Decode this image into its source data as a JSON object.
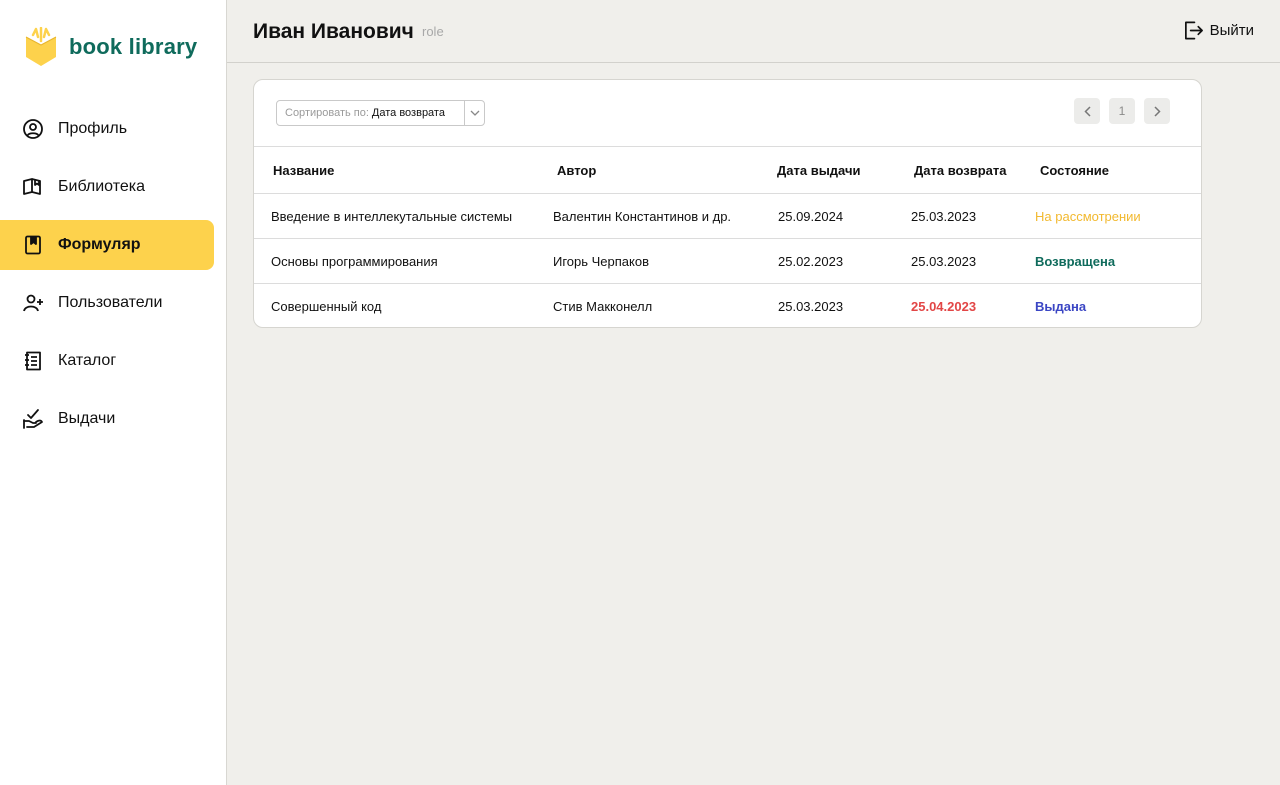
{
  "app": {
    "logo_text": "book library"
  },
  "sidebar": {
    "items": [
      {
        "label": "Профиль",
        "icon": "user-circle-icon",
        "active": false
      },
      {
        "label": "Библиотека",
        "icon": "open-book-icon",
        "active": false
      },
      {
        "label": "Формуляр",
        "icon": "bookmark-book-icon",
        "active": true
      },
      {
        "label": "Пользователи",
        "icon": "user-add-icon",
        "active": false
      },
      {
        "label": "Каталог",
        "icon": "catalog-icon",
        "active": false
      },
      {
        "label": "Выдачи",
        "icon": "hand-check-icon",
        "active": false
      }
    ]
  },
  "header": {
    "user_name": "Иван Иванович",
    "role": "role",
    "logout_label": "Выйти"
  },
  "toolbar": {
    "sort_prefix": "Сортировать по:",
    "sort_value": "Дата возврата",
    "page_number": "1"
  },
  "table": {
    "columns": [
      "Название",
      "Автор",
      "Дата выдачи",
      "Дата возврата",
      "Состояние"
    ],
    "rows": [
      {
        "title": "Введение в интеллекутальные системы",
        "author": "Валентин Константинов и др.",
        "issued": "25.09.2024",
        "returned": "25.03.2023",
        "status": "На рассмотрении"
      },
      {
        "title": "Основы программирования",
        "author": "Игорь Черпаков",
        "issued": "25.02.2023",
        "returned": "25.03.2023",
        "status": "Возвращена"
      },
      {
        "title": "Совершенный код",
        "author": "Стив Макконелл",
        "issued": "25.03.2023",
        "returned": "25.04.2023",
        "status": "Выдана"
      }
    ]
  },
  "colors": {
    "accent": "#fdd24c",
    "brand": "#0f6b5c",
    "status_pending": "#f2b92f",
    "status_returned": "#0f6b5c",
    "status_issued": "#3b46c4",
    "overdue": "#e24646"
  }
}
